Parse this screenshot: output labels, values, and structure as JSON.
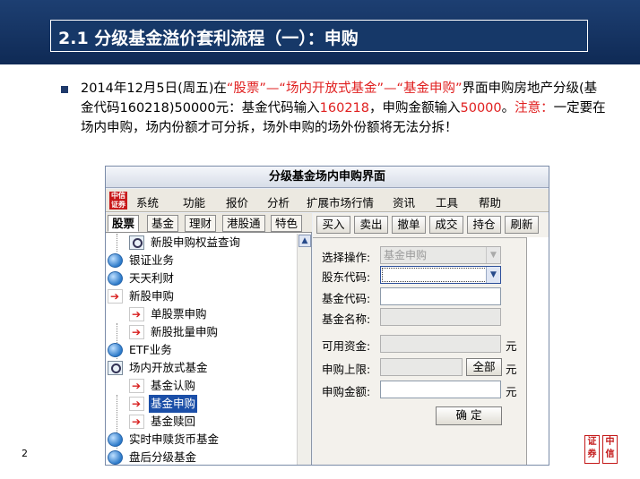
{
  "slide": {
    "title": "2.1 分级基金溢价套利流程（一）：申购",
    "page_number": "2"
  },
  "paragraph": {
    "p1": "2014年12月5日(周五)在",
    "p2": "“股票”—“场内开放式基金”—“基金申购”",
    "p3": "界面申购房地产分级(基金代码160218)50000元：基金代码输入",
    "p4": "160218",
    "p5": "，申购金额输入",
    "p6": "50000",
    "p7": "。",
    "p8": "注意：",
    "p9": "一定要在场内申购，场内份额才可分拆，场外申购的场外份额将无法分拆！"
  },
  "window": {
    "title": "分级基金场内申购界面",
    "logo": "中信证券",
    "menu": [
      "系统",
      "功能",
      "报价",
      "分析",
      "扩展市场行情",
      "资讯",
      "工具",
      "帮助"
    ],
    "left_tabs": [
      "股票",
      "基金",
      "理财",
      "港股通",
      "特色"
    ],
    "tree": [
      {
        "label": "新股申购权益查询",
        "icon": "search-icon"
      },
      {
        "label": "银证业务",
        "icon": "globe-icon"
      },
      {
        "label": "天天利财",
        "icon": "globe-icon"
      },
      {
        "label": "新股申购",
        "icon": "arrow-icon"
      },
      {
        "label": "单股票申购",
        "icon": "arrow-icon"
      },
      {
        "label": "新股批量申购",
        "icon": "arrow-icon"
      },
      {
        "label": "ETF业务",
        "icon": "globe-icon"
      },
      {
        "label": "场内开放式基金",
        "icon": "search-icon"
      },
      {
        "label": "基金认购",
        "icon": "arrow-icon"
      },
      {
        "label": "基金申购",
        "icon": "arrow-icon"
      },
      {
        "label": "基金赎回",
        "icon": "arrow-icon"
      },
      {
        "label": "实时申赎货币基金",
        "icon": "globe-icon"
      },
      {
        "label": "盘后分级基金",
        "icon": "globe-icon"
      }
    ],
    "toolbar": [
      "买入",
      "卖出",
      "撤单",
      "成交",
      "持仓",
      "刷新"
    ],
    "form": {
      "operation_label": "选择操作:",
      "operation_value": "基金申购",
      "account_label": "股东代码:",
      "account_value": "",
      "fund_code_label": "基金代码:",
      "fund_code_value": "",
      "fund_name_label": "基金名称:",
      "fund_name_value": "",
      "available_label": "可用资金:",
      "available_value": "",
      "limit_label": "申购上限:",
      "limit_value": "",
      "amount_label": "申购金额:",
      "amount_value": "",
      "unit": "元",
      "all_button": "全部",
      "confirm_button": "确 定"
    }
  },
  "colors": {
    "header_bg": "#163868",
    "highlight_red": "#e02020",
    "selection_blue": "#1b4fa8"
  }
}
